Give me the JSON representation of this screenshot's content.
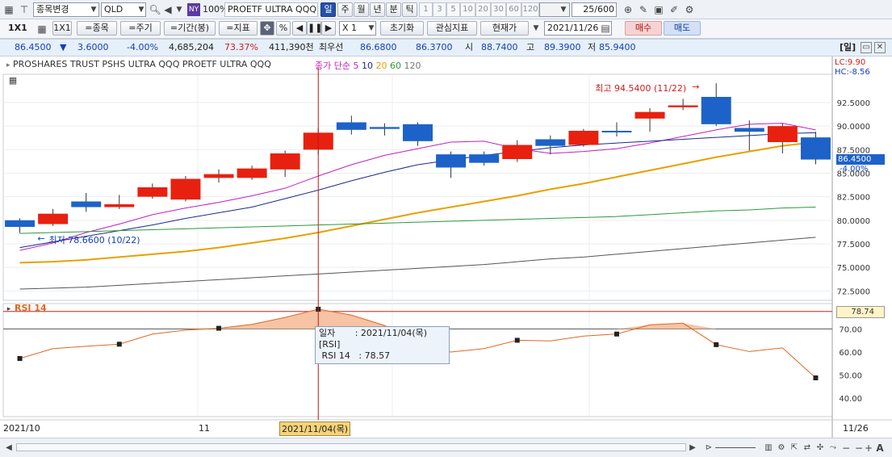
{
  "toolbar": {
    "change_symbol_label": "종목변경",
    "symbol": "QLD",
    "exchange_badge": "NY",
    "zoom": "100%",
    "symbol_name": "PROETF ULTRA QQQ",
    "periods": [
      "일",
      "주",
      "월",
      "년",
      "분",
      "틱"
    ],
    "intervals": [
      "1",
      "3",
      "5",
      "10",
      "20",
      "30",
      "60",
      "120"
    ],
    "count": "25",
    "count_total": "/600"
  },
  "toolbar2": {
    "layout_label": "1X1",
    "layout_btn": "1X1",
    "btn_symbol": "=종목",
    "btn_period": "=주기",
    "btn_range": "=기간(봉)",
    "btn_indicator": "=지표",
    "mult": "X 1",
    "reset": "초기화",
    "watch_indicator": "관심지표",
    "current_price": "현재가",
    "date": "2021/11/26",
    "buy": "매수",
    "sell": "매도"
  },
  "quote": {
    "price": "86.4500",
    "arrow": "▼",
    "change": "3.6000",
    "pct": "-4.00%",
    "volume": "4,685,204",
    "vol_ratio": "73.37%",
    "turnover": "411,390천",
    "best_bid_label": "최우선",
    "best_ask": "86.6800",
    "best_bid": "86.3700",
    "open_label": "시",
    "open": "88.7400",
    "high_label": "고",
    "high": "89.3900",
    "low_label": "저",
    "low": "85.9400",
    "period_badge": "[일]"
  },
  "chart_title": "PROSHARES TRUST PSHS ULTRA QQQ  PROETF ULTRA QQQ",
  "ma_legend": {
    "label": "종가 단순",
    "p5": "5",
    "p10": "10",
    "p20": "20",
    "p60": "60",
    "p120": "120"
  },
  "lc": "LC:9.90",
  "hc": "HC:-8.56",
  "last_price_tag": "86.4500",
  "last_pct_tag": "-4.00%",
  "annot_high": "최고 94.5400 (11/22)",
  "annot_low": "최저 78.6600 (10/22)",
  "rsi_title": "RSI 14",
  "rsi_value_tag": "78.74",
  "tooltip": {
    "date_label": "일자",
    "date_value": ": 2021/11/04(목)",
    "section": "[RSI]",
    "rsi_label": "RSI 14",
    "rsi_value": ": 78.57"
  },
  "xaxis": {
    "left": "2021/10",
    "mid": "11",
    "cursor": "2021/11/04(목)",
    "right": "11/26"
  },
  "colors": {
    "up": "#e8200f",
    "down": "#1d62c9",
    "ma5": "#c020c0",
    "ma10": "#1a2a8a",
    "ma20": "#e8a000",
    "ma60": "#2a9a3a",
    "ma120": "#555555",
    "rsi": "#e06820"
  },
  "chart_data": [
    {
      "type": "candlestick",
      "title": "PROSHARES TRUST PSHS ULTRA QQQ  PROETF ULTRA QQQ",
      "ylim": [
        71.5,
        95.5
      ],
      "yticks": [
        72.5,
        75.0,
        77.5,
        80.0,
        82.5,
        85.0,
        87.5,
        90.0,
        92.5
      ],
      "candles": [
        {
          "o": 80.0,
          "c": 79.3,
          "h": 80.2,
          "l": 78.66
        },
        {
          "o": 79.6,
          "c": 80.7,
          "h": 81.2,
          "l": 79.4
        },
        {
          "o": 82.0,
          "c": 81.4,
          "h": 82.9,
          "l": 80.9
        },
        {
          "o": 81.4,
          "c": 81.7,
          "h": 82.7,
          "l": 81.2
        },
        {
          "o": 82.5,
          "c": 83.5,
          "h": 83.9,
          "l": 82.3
        },
        {
          "o": 82.2,
          "c": 84.4,
          "h": 84.7,
          "l": 82.0
        },
        {
          "o": 84.5,
          "c": 84.9,
          "h": 85.4,
          "l": 84.0
        },
        {
          "o": 84.5,
          "c": 85.5,
          "h": 85.8,
          "l": 84.3
        },
        {
          "o": 85.4,
          "c": 87.1,
          "h": 87.4,
          "l": 84.6
        },
        {
          "o": 87.5,
          "c": 89.3,
          "h": 89.8,
          "l": 87.0
        },
        {
          "o": 90.4,
          "c": 89.6,
          "h": 91.1,
          "l": 89.1
        },
        {
          "o": 89.9,
          "c": 89.7,
          "h": 90.3,
          "l": 89.0
        },
        {
          "o": 90.2,
          "c": 88.4,
          "h": 90.4,
          "l": 87.9
        },
        {
          "o": 87.0,
          "c": 85.6,
          "h": 87.3,
          "l": 84.5
        },
        {
          "o": 87.0,
          "c": 86.1,
          "h": 87.3,
          "l": 85.8
        },
        {
          "o": 86.5,
          "c": 88.0,
          "h": 88.5,
          "l": 86.2
        },
        {
          "o": 88.6,
          "c": 87.9,
          "h": 89.0,
          "l": 87.0
        },
        {
          "o": 88.0,
          "c": 89.5,
          "h": 89.7,
          "l": 87.8
        },
        {
          "o": 89.5,
          "c": 89.4,
          "h": 90.4,
          "l": 88.9
        },
        {
          "o": 90.8,
          "c": 91.5,
          "h": 91.9,
          "l": 89.4
        },
        {
          "o": 92.0,
          "c": 92.2,
          "h": 92.9,
          "l": 91.7
        },
        {
          "o": 93.1,
          "c": 90.2,
          "h": 94.54,
          "l": 90.0
        },
        {
          "o": 89.8,
          "c": 89.4,
          "h": 90.6,
          "l": 87.4
        },
        {
          "o": 88.3,
          "c": 90.0,
          "h": 90.3,
          "l": 87.1
        },
        {
          "o": 88.8,
          "c": 86.45,
          "h": 89.39,
          "l": 85.94
        }
      ],
      "series": [
        {
          "name": "5",
          "values": [
            76.8,
            77.6,
            78.7,
            79.6,
            80.6,
            81.3,
            81.9,
            82.6,
            83.4,
            84.7,
            85.9,
            86.9,
            87.6,
            88.3,
            88.4,
            87.6,
            87.1,
            87.3,
            87.6,
            88.2,
            88.9,
            89.6,
            90.2,
            90.3,
            89.6
          ]
        },
        {
          "name": "10",
          "values": [
            77.1,
            77.7,
            78.3,
            78.9,
            79.5,
            80.2,
            80.8,
            81.4,
            82.3,
            83.2,
            84.2,
            85.1,
            85.9,
            86.4,
            86.9,
            87.3,
            87.7,
            88.0,
            88.2,
            88.4,
            88.6,
            88.8,
            89.0,
            89.2,
            89.3
          ]
        },
        {
          "name": "20",
          "values": [
            75.5,
            75.6,
            75.8,
            76.1,
            76.4,
            76.7,
            77.1,
            77.6,
            78.1,
            78.7,
            79.4,
            80.1,
            80.8,
            81.4,
            82.0,
            82.6,
            83.3,
            83.9,
            84.6,
            85.3,
            86.0,
            86.7,
            87.3,
            87.9,
            88.3
          ]
        },
        {
          "name": "60",
          "values": [
            78.6,
            78.7,
            78.8,
            78.9,
            79.0,
            79.1,
            79.2,
            79.3,
            79.4,
            79.5,
            79.6,
            79.7,
            79.8,
            79.9,
            80.0,
            80.1,
            80.2,
            80.3,
            80.4,
            80.6,
            80.8,
            81.0,
            81.1,
            81.3,
            81.4
          ]
        },
        {
          "name": "120",
          "values": [
            72.7,
            72.8,
            72.9,
            73.1,
            73.3,
            73.5,
            73.7,
            73.9,
            74.1,
            74.3,
            74.5,
            74.7,
            74.9,
            75.1,
            75.3,
            75.6,
            75.9,
            76.1,
            76.4,
            76.7,
            77.0,
            77.3,
            77.6,
            77.9,
            78.2
          ]
        }
      ]
    },
    {
      "type": "line",
      "title": "RSI 14",
      "ylim": [
        32,
        81
      ],
      "yticks": [
        40.0,
        50.0,
        60.0,
        70.0
      ],
      "series": [
        {
          "name": "RSI 14",
          "values": [
            57.2,
            61.5,
            62.5,
            63.4,
            67.8,
            69.5,
            70.3,
            72.0,
            75.0,
            78.57,
            76.0,
            71.5,
            62.8,
            60.0,
            61.5,
            65.1,
            64.8,
            66.9,
            67.8,
            71.8,
            72.5,
            63.2,
            60.2,
            61.8,
            48.8
          ]
        }
      ]
    }
  ]
}
